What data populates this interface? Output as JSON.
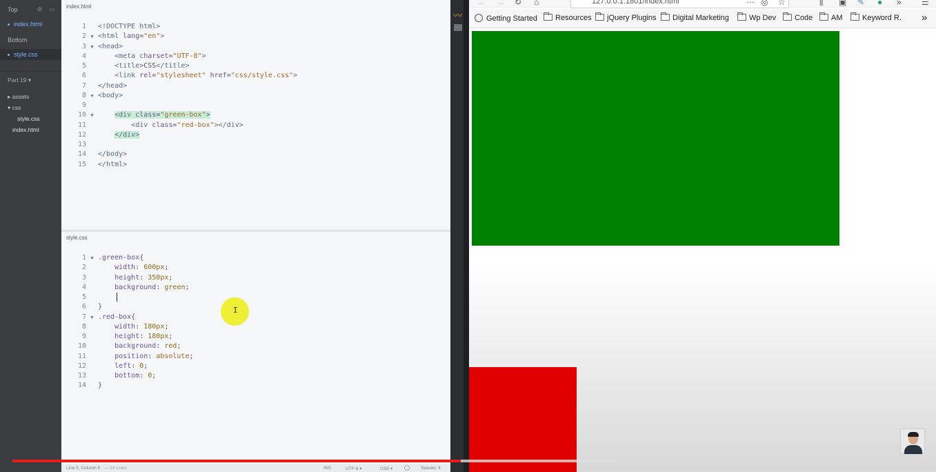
{
  "sidebar": {
    "top_label": "Top",
    "top_files": [
      "index.html"
    ],
    "bottom_label": "Bottom",
    "bottom_files": [
      "style.css"
    ],
    "project_label": "Part 19 ▾",
    "tree": {
      "assets": "▸ assets",
      "css": "▾ css",
      "style": "style.css",
      "index": "index.html"
    }
  },
  "editor": {
    "html_pane": {
      "title": "index.html",
      "lines": [
        {
          "n": "1",
          "fold": "",
          "html": "<span class='tag'>&lt;!DOCTYPE html&gt;</span>"
        },
        {
          "n": "2",
          "fold": "▼",
          "html": "<span class='tag'>&lt;html</span> <span class='attr'>lang</span>=<span class='str'>\"en\"</span><span class='tag'>&gt;</span>"
        },
        {
          "n": "3",
          "fold": "▼",
          "html": "<span class='tag'>&lt;head&gt;</span>"
        },
        {
          "n": "4",
          "fold": "",
          "html": "    <span class='tag'>&lt;meta</span> <span class='attr'>charset</span>=<span class='str'>\"UTF-8\"</span><span class='tag'>&gt;</span>"
        },
        {
          "n": "5",
          "fold": "",
          "html": "    <span class='tag'>&lt;title&gt;</span>CSS<span class='tag'>&lt;/title&gt;</span>"
        },
        {
          "n": "6",
          "fold": "",
          "html": "    <span class='tag'>&lt;link</span> <span class='attr'>rel</span>=<span class='str'>\"stylesheet\"</span> <span class='attr'>href</span>=<span class='str'>\"css/style.css\"</span><span class='tag'>&gt;</span>"
        },
        {
          "n": "7",
          "fold": "",
          "html": "<span class='tag'>&lt;/head&gt;</span>"
        },
        {
          "n": "8",
          "fold": "▼",
          "html": "<span class='tag'>&lt;body&gt;</span>"
        },
        {
          "n": "9",
          "fold": "",
          "html": ""
        },
        {
          "n": "10",
          "fold": "▼",
          "html": "    <span class='hl'><span class='tag'>&lt;div</span> <span class='attr'>class</span>=<span class='str'>\"green-box\"</span><span class='tag'>&gt;</span></span>"
        },
        {
          "n": "11",
          "fold": "",
          "html": "        <span class='tag'>&lt;div</span> <span class='attr'>class</span>=<span class='str'>\"red-box\"</span><span class='tag'>&gt;&lt;/div&gt;</span>"
        },
        {
          "n": "12",
          "fold": "",
          "html": "    <span class='hl'><span class='tag'>&lt;/div&gt;</span></span>"
        },
        {
          "n": "13",
          "fold": "",
          "html": ""
        },
        {
          "n": "14",
          "fold": "",
          "html": "<span class='tag'>&lt;/body&gt;</span>"
        },
        {
          "n": "15",
          "fold": "",
          "html": "<span class='tag'>&lt;/html&gt;</span>"
        }
      ]
    },
    "css_pane": {
      "title": "style.css",
      "lines": [
        {
          "n": "1",
          "fold": "▼",
          "html": "<span class='sel'>.green-box</span>{"
        },
        {
          "n": "2",
          "fold": "",
          "html": "    <span class='prop'>width</span>: <span class='val'>600px</span>;"
        },
        {
          "n": "3",
          "fold": "",
          "html": "    <span class='prop'>height</span>: <span class='val'>350px</span>;"
        },
        {
          "n": "4",
          "fold": "",
          "html": "    <span class='prop'>background</span>: <span class='val'>green</span>;"
        },
        {
          "n": "5",
          "fold": "",
          "html": ""
        },
        {
          "n": "6",
          "fold": "",
          "html": "}"
        },
        {
          "n": "7",
          "fold": "▼",
          "html": "<span class='sel'>.red-box</span>{"
        },
        {
          "n": "8",
          "fold": "",
          "html": "    <span class='prop'>width</span>: <span class='val'>180px</span>;"
        },
        {
          "n": "9",
          "fold": "",
          "html": "    <span class='prop'>height</span>: <span class='val'>180px</span>;"
        },
        {
          "n": "10",
          "fold": "",
          "html": "    <span class='prop'>background</span>: <span class='val'>red</span>;"
        },
        {
          "n": "11",
          "fold": "",
          "html": "    <span class='prop'>position</span>: <span class='str'>absolute</span>;"
        },
        {
          "n": "12",
          "fold": "",
          "html": "    <span class='prop'>left</span>: <span class='val'>0</span>;"
        },
        {
          "n": "13",
          "fold": "",
          "html": "    <span class='prop'>bottom</span>: <span class='val'>0</span>;"
        },
        {
          "n": "14",
          "fold": "",
          "html": "}"
        }
      ]
    },
    "status": {
      "position": "Line 5, Column 5",
      "lines": "— 14 Lines",
      "mode": "INS",
      "encoding": "UTF-8 ▾",
      "language": "CSS ▾",
      "spaces": "Spaces: 4"
    }
  },
  "browser": {
    "url": "127.0.0.1:1801/index.html",
    "bookmarks": [
      "Getting Started",
      "Resources",
      "jQuery Plugins",
      "Digital Marketing",
      "Wp Dev",
      "Code",
      "AM",
      "Keyword R."
    ],
    "more": "»",
    "colors": {
      "green_box": "#008000",
      "red_box": "#e00000"
    }
  },
  "video": {
    "progress": 0.74
  }
}
